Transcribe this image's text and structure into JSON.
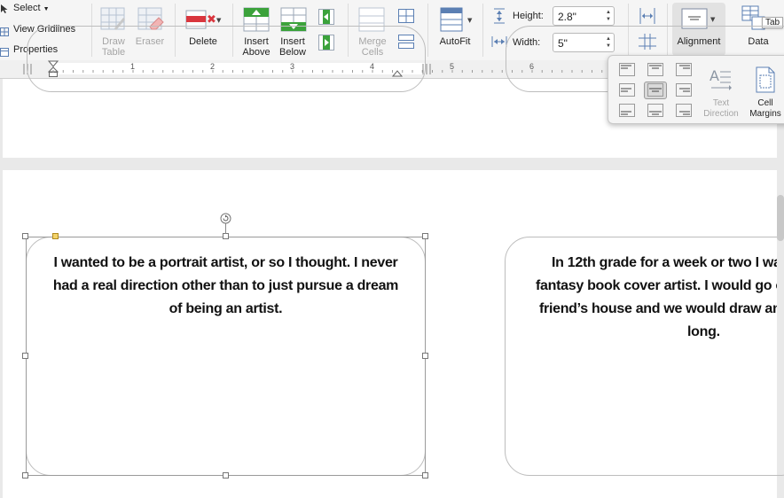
{
  "ribbon": {
    "select_label": "Select",
    "view_gridlines_label": "View Gridlines",
    "properties_label": "Properties",
    "draw_table_label": [
      "Draw",
      "Table"
    ],
    "eraser_label": "Eraser",
    "delete_label": "Delete",
    "insert_above_label": [
      "Insert",
      "Above"
    ],
    "insert_below_label": [
      "Insert",
      "Below"
    ],
    "merge_cells_label": [
      "Merge",
      "Cells"
    ],
    "autofit_label": "AutoFit",
    "height_label": "Height:",
    "height_value": "2.8\"",
    "width_label": "Width:",
    "width_value": "5\"",
    "alignment_label": "Alignment",
    "data_label": "Data",
    "tooltip_label": "Tab"
  },
  "ruler": {
    "numbers": [
      "1",
      "2",
      "3",
      "4",
      "5",
      "6"
    ]
  },
  "alignment_popover": {
    "text_direction_label": [
      "Text",
      "Direction"
    ],
    "cell_margins_label": [
      "Cell",
      "Margins"
    ],
    "selected": "center-middle"
  },
  "document": {
    "card1_text": "I wanted to be a portrait artist, or so I thought. I never had a real direction other than to just pursue a dream of being an artist.",
    "card2_lines": [
      "In 12th grade for a week or two I wa",
      "fantasy book cover artist. I would go o",
      "friend’s house and we would draw an",
      "long."
    ]
  },
  "colors": {
    "accent_green": "#3ba23b",
    "accent_red": "#d9363e",
    "selection_handle_yellow": "#f3d36a"
  }
}
